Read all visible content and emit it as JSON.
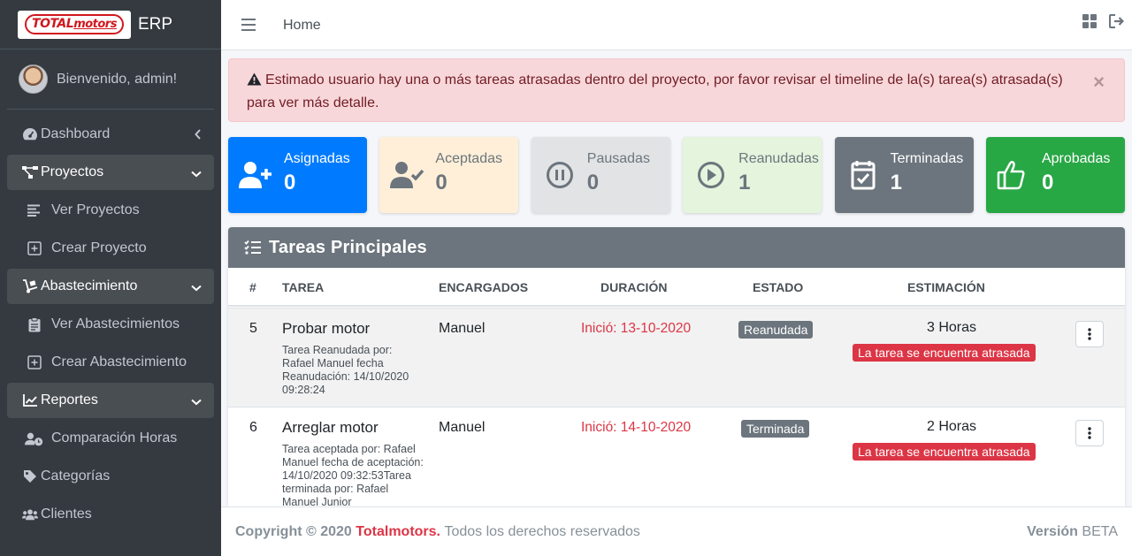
{
  "brand": {
    "logo_text_a": "TOTAL",
    "logo_text_b": "motors",
    "app_name": "ERP"
  },
  "user": {
    "greeting": "Bienvenido, admin!"
  },
  "sidebar": {
    "items": [
      {
        "label": "Dashboard",
        "icon": "tachometer-icon"
      },
      {
        "label": "Proyectos",
        "icon": "project-diagram-icon"
      },
      {
        "label": "Ver Proyectos",
        "icon": "list-icon"
      },
      {
        "label": "Crear Proyecto",
        "icon": "plus-square-icon"
      },
      {
        "label": "Abastecimiento",
        "icon": "dolly-icon"
      },
      {
        "label": "Ver Abastecimientos",
        "icon": "clipboard-icon"
      },
      {
        "label": "Crear Abastecimiento",
        "icon": "plus-square-icon"
      },
      {
        "label": "Reportes",
        "icon": "chart-line-icon"
      },
      {
        "label": "Comparación Horas",
        "icon": "user-clock-icon"
      },
      {
        "label": "Categorías",
        "icon": "tag-icon"
      },
      {
        "label": "Clientes",
        "icon": "users-icon"
      }
    ]
  },
  "header": {
    "breadcrumb": "Home"
  },
  "alert": {
    "text": "Estimado usuario hay una o más tareas atrasadas dentro del proyecto, por favor revisar el timeline de la(s) tarea(s) atrasada(s) para ver más detalle.",
    "close": "×"
  },
  "stats": [
    {
      "label": "Asignadas",
      "value": "0",
      "color": "#007bff"
    },
    {
      "label": "Aceptadas",
      "value": "0",
      "color": "#ffefd8"
    },
    {
      "label": "Pausadas",
      "value": "0",
      "color": "#e2e3e5"
    },
    {
      "label": "Reanudadas",
      "value": "1",
      "color": "#e4f4dd"
    },
    {
      "label": "Terminadas",
      "value": "1",
      "color": "#6c757d"
    },
    {
      "label": "Aprobadas",
      "value": "0",
      "color": "#28a745"
    }
  ],
  "tasks": {
    "title": "Tareas Principales",
    "columns": [
      "#",
      "TAREA",
      "ENCARGADOS",
      "DURACIÓN",
      "ESTADO",
      "ESTIMACIÓN"
    ],
    "rows": [
      {
        "num": "5",
        "name": "Probar motor",
        "desc": "Tarea Reanudada por: Rafael Manuel fecha Reanudación: 14/10/2020 09:28:24",
        "assignee": "Manuel",
        "duration": "Inició: 13-10-2020",
        "state": "Reanudada",
        "estimate": "3 Horas",
        "late": "La tarea se encuentra atrasada"
      },
      {
        "num": "6",
        "name": "Arreglar motor",
        "desc": "Tarea aceptada por: Rafael Manuel fecha de aceptación: 14/10/2020 09:32:53Tarea terminada por: Rafael Manuel Junior",
        "assignee": "Manuel",
        "duration": "Inició: 14-10-2020",
        "state": "Terminada",
        "estimate": "2 Horas",
        "late": "La tarea se encuentra atrasada"
      }
    ]
  },
  "footer": {
    "copyright": "Copyright © 2020",
    "company": "Totalmotors.",
    "rights": "Todos los derechos reservados",
    "version_label": "Versión",
    "version_value": "BETA"
  }
}
